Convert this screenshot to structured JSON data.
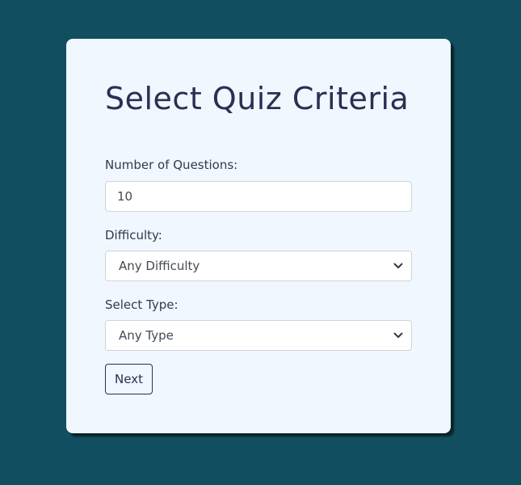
{
  "form": {
    "title": "Select Quiz Criteria",
    "questions_label": "Number of Questions:",
    "questions_value": "10",
    "difficulty_label": "Difficulty:",
    "difficulty_selected": "Any Difficulty",
    "type_label": "Select Type:",
    "type_selected": "Any Type",
    "next_label": "Next"
  },
  "colors": {
    "page_background": "#114e60",
    "card_background": "#f0f7ff",
    "title_text": "#2b2f52",
    "button_border": "#2b2f52"
  }
}
